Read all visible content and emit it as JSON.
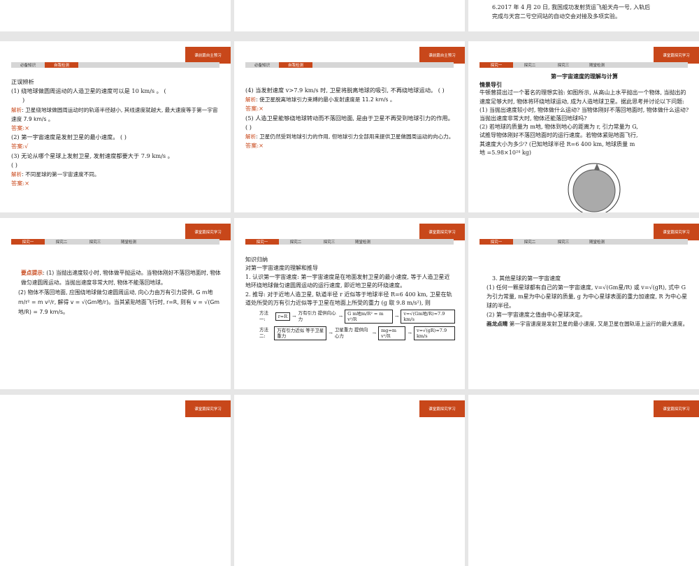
{
  "slides": {
    "s1": {
      "text": ""
    },
    "s3": {
      "line1": "6.2017 年 4 月 20 日, 我国成功发射货运飞船天舟一号, 入轨后",
      "line2": "完成与天宫二号空间站的自动交会对接及多项实验。"
    },
    "s4": {
      "header": "课前篇自主预习",
      "tabs": [
        "必备知识",
        "自我检测"
      ],
      "title": "正误辨析",
      "q1": "(1) 绕地球做圆周运动的人造卫星的速度可以是 10 km/s 。 (",
      "q1b": ")",
      "a1_label": "解析",
      "a1": ": 卫星绕地球做圆周运动时的轨道半径越小, 其线速度就越大, 最大速度等于第一宇宙速度 7.9 km/s 。",
      "ans_label": "答案",
      "ans1": ":×",
      "q2": "(2) 第一宇宙速度是发射卫星的最小速度。 (          )",
      "ans2": ":√",
      "q3": "(3) 无论从哪个星球上发射卫星, 发射速度都要大于 7.9 km/s 。",
      "q3b": "(          )",
      "a3": ": 不同星球的第一宇宙速度不同。",
      "ans3": ":×"
    },
    "s5": {
      "header": "课前篇自主预习",
      "tabs": [
        "必备知识",
        "自我检测"
      ],
      "q4": "(4) 当发射速度 v>7.9 km/s 时, 卫星将脱离地球的吸引, 不再绕地球运动。 (          )",
      "a4": ": 使卫星脱离地球引力束缚的最小发射速度是 11.2 km/s 。",
      "ans4": ":×",
      "q5": "(5) 人造卫星能够绕地球转动而不落回地面, 是由于卫星不再受到地球引力的作用。 (          )",
      "a5": ": 卫星仍然受到地球引力的作用, 但地球引力全部用来提供卫星做圆周运动的向心力。",
      "ans5": ":×",
      "a_label": "解析",
      "ans_label": "答案"
    },
    "s6": {
      "header": "课堂篇探究学习",
      "tabs": [
        "探究一",
        "探究二",
        "探究三",
        "随堂检测"
      ],
      "title": "第一宇宙速度的理解与计算",
      "sub": "情景导引",
      "p1": "牛顿曾提出过一个著名的理想实验: 如图所示, 从高山上水平抛出一个物体, 当抛出的速度足够大时, 物体将环绕地球运动, 成为人造地球卫星。据此思考并讨论以下问题:",
      "p2": "(1) 当抛出速度较小时, 物体做什么运动? 当物体刚好不落回地面时, 物体做什么运动? 当抛出速度非常大时, 物体还能落回地球吗?",
      "p3": "(2) 若地球的质量为 m地, 物体到地心的距离为 r, 引力常量为 G, 试推导物体刚好不落回地面时的运行速度。若物体紧贴地面飞行, 其速度大小为多少? (已知地球半径 R=6 400 km, 地球质量 m地 =5.98×10²⁴ kg)"
    },
    "s7": {
      "header": "课堂篇探究学习",
      "tabs": [
        "探究一",
        "探究二",
        "探究三",
        "随堂检测"
      ],
      "label": "要点提示",
      "p1": ": (1) 当抛出速度较小时, 物体做平抛运动。当物体刚好不落回地面时, 物体做匀速圆周运动。当抛出速度非常大时, 物体不能落回地球。",
      "p2": "(2) 物体不落回地面, 应围绕地球做匀速圆周运动, 向心力由万有引力提供, G m地m/r² = m v²/r, 解得 v = √(Gm地/r)。当其紧贴地面飞行时, r=R, 则有 v = √(Gm地/R) = 7.9 km/s。"
    },
    "s8": {
      "header": "课堂篇探究学习",
      "tabs": [
        "探究一",
        "探究二",
        "探究三",
        "随堂检测"
      ],
      "t1": "知识归纳",
      "t2": "对第一宇宙速度的理解和推导",
      "p1": "1. 认识第一宇宙速度: 第一宇宙速度是在地面发射卫星的最小速度, 等于人造卫星近地环绕地球做匀速圆周运动的运行速度, 即近地卫星的环绕速度。",
      "p2": "2. 推导: 对于近地人造卫星, 轨道半径 r 近似等于地球半径 R=6 400 km, 卫星在轨道处所受的万有引力近似等于卫星在地面上所受的重力 (g 取 9.8 m/s²), 则",
      "m1": "方法一:",
      "m2": "方法二:",
      "f1a": "r≈R",
      "f1b": "万有引力 提供向心力",
      "f1c": "G m地m/R² = m v²/R",
      "f1d": "v=√(Gm地/R)≈7.9 km/s",
      "f2a": "万有引力近似 等于卫星重力",
      "f2b": "卫星重力 提供向心力",
      "f2c": "mg=m v²/R",
      "f2d": "v=√(gR)≈7.9 km/s"
    },
    "s9": {
      "header": "课堂篇探究学习",
      "tabs": [
        "探究一",
        "探究二",
        "探究三",
        "随堂检测"
      ],
      "p1": "3. 其他星球的第一宇宙速度",
      "p2": "(1) 任何一颗星球都有自己的第一宇宙速度, v=√(Gm星/R) 或 v=√(gR), 式中 G 为引力常量, m星为中心星球的质量, g 为中心星球表面的重力加速度, R 为中心星球的半径。",
      "p3": "(2) 第一宇宙速度之值由中心星球决定。",
      "label": "画龙点睛",
      "p4": "第一宇宙速度是发射卫星的最小速度, 又是卫星在圆轨道上运行的最大速度。"
    },
    "bottom": {
      "header": "课堂篇探究学习"
    }
  }
}
